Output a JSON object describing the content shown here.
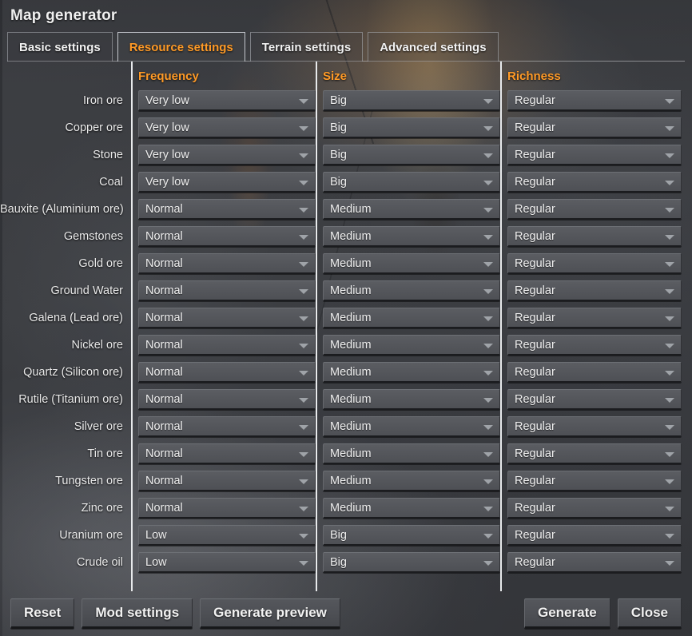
{
  "window": {
    "title": "Map generator"
  },
  "tabs": [
    {
      "label": "Basic settings",
      "active": false
    },
    {
      "label": "Resource settings",
      "active": true
    },
    {
      "label": "Terrain settings",
      "active": false
    },
    {
      "label": "Advanced settings",
      "active": false
    }
  ],
  "columns": {
    "label_header": "",
    "frequency": "Frequency",
    "size": "Size",
    "richness": "Richness"
  },
  "rows": [
    {
      "label": "Iron ore",
      "frequency": "Very low",
      "size": "Big",
      "richness": "Regular"
    },
    {
      "label": "Copper ore",
      "frequency": "Very low",
      "size": "Big",
      "richness": "Regular"
    },
    {
      "label": "Stone",
      "frequency": "Very low",
      "size": "Big",
      "richness": "Regular"
    },
    {
      "label": "Coal",
      "frequency": "Very low",
      "size": "Big",
      "richness": "Regular"
    },
    {
      "label": "Bauxite (Aluminium ore)",
      "frequency": "Normal",
      "size": "Medium",
      "richness": "Regular"
    },
    {
      "label": "Gemstones",
      "frequency": "Normal",
      "size": "Medium",
      "richness": "Regular"
    },
    {
      "label": "Gold ore",
      "frequency": "Normal",
      "size": "Medium",
      "richness": "Regular"
    },
    {
      "label": "Ground Water",
      "frequency": "Normal",
      "size": "Medium",
      "richness": "Regular"
    },
    {
      "label": "Galena (Lead ore)",
      "frequency": "Normal",
      "size": "Medium",
      "richness": "Regular"
    },
    {
      "label": "Nickel ore",
      "frequency": "Normal",
      "size": "Medium",
      "richness": "Regular"
    },
    {
      "label": "Quartz (Silicon ore)",
      "frequency": "Normal",
      "size": "Medium",
      "richness": "Regular"
    },
    {
      "label": "Rutile (Titanium ore)",
      "frequency": "Normal",
      "size": "Medium",
      "richness": "Regular"
    },
    {
      "label": "Silver ore",
      "frequency": "Normal",
      "size": "Medium",
      "richness": "Regular"
    },
    {
      "label": "Tin ore",
      "frequency": "Normal",
      "size": "Medium",
      "richness": "Regular"
    },
    {
      "label": "Tungsten ore",
      "frequency": "Normal",
      "size": "Medium",
      "richness": "Regular"
    },
    {
      "label": "Zinc ore",
      "frequency": "Normal",
      "size": "Medium",
      "richness": "Regular"
    },
    {
      "label": "Uranium ore",
      "frequency": "Low",
      "size": "Big",
      "richness": "Regular"
    },
    {
      "label": "Crude oil",
      "frequency": "Low",
      "size": "Big",
      "richness": "Regular"
    }
  ],
  "footer": {
    "left": [
      "Reset",
      "Mod settings",
      "Generate preview"
    ],
    "right": [
      "Generate",
      "Close"
    ]
  },
  "icons": {
    "dropdown_arrow": "chevron-down-icon"
  },
  "colors": {
    "accent_orange": "#ff9a26",
    "text": "#f0f0f0",
    "dropdown_bg": "#55575c",
    "panel_bg": "#44464a",
    "separator": "#e8eaec"
  }
}
